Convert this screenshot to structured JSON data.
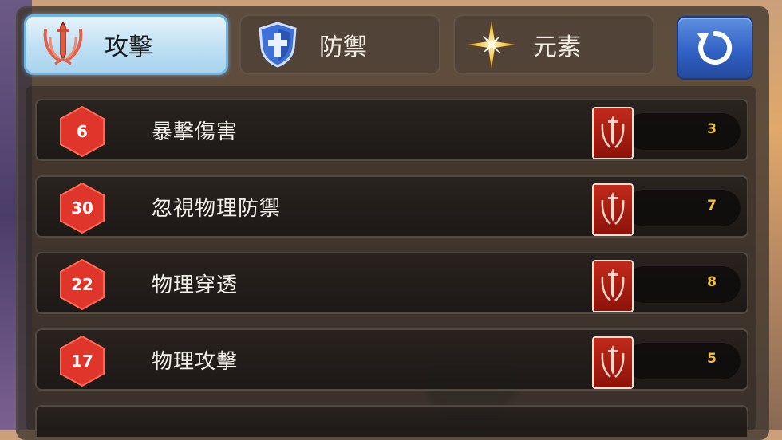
{
  "tabs": [
    {
      "label": "攻擊",
      "icon": "sword-crest-icon",
      "active": true
    },
    {
      "label": "防禦",
      "icon": "shield-cross-icon",
      "active": false
    },
    {
      "label": "元素",
      "icon": "star-burst-icon",
      "active": false
    }
  ],
  "refresh_icon": "refresh-icon",
  "stats": [
    {
      "level": "6",
      "label": "暴擊傷害",
      "count": "3"
    },
    {
      "level": "30",
      "label": "忽視物理防禦",
      "count": "7"
    },
    {
      "level": "22",
      "label": "物理穿透",
      "count": "8"
    },
    {
      "level": "17",
      "label": "物理攻擊",
      "count": "5"
    }
  ],
  "colors": {
    "active_tab": "#bfe0f3",
    "badge_red": "#e0352a",
    "count_gold": "#f2c23a",
    "refresh_blue": "#2f5fc2"
  }
}
